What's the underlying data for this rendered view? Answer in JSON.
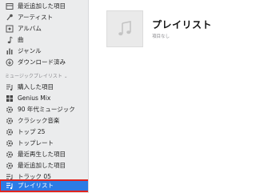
{
  "sidebar": {
    "library_items": [
      {
        "label": "最近追加した項目",
        "icon": "recently-added-icon"
      },
      {
        "label": "アーティスト",
        "icon": "artist-icon"
      },
      {
        "label": "アルバム",
        "icon": "album-icon"
      },
      {
        "label": "曲",
        "icon": "song-icon"
      },
      {
        "label": "ジャンル",
        "icon": "genre-icon"
      },
      {
        "label": "ダウンロード済み",
        "icon": "downloaded-icon"
      }
    ],
    "playlists_header": "ミュージックプレイリスト",
    "playlists": [
      {
        "label": "購入した項目",
        "icon": "playlist-icon"
      },
      {
        "label": "Genius Mix",
        "icon": "genius-mix-icon"
      },
      {
        "label": "90 年代ミュージック",
        "icon": "smart-playlist-icon"
      },
      {
        "label": "クラシック音楽",
        "icon": "smart-playlist-icon"
      },
      {
        "label": "トップ 25",
        "icon": "smart-playlist-icon"
      },
      {
        "label": "トップレート",
        "icon": "smart-playlist-icon"
      },
      {
        "label": "最近再生した項目",
        "icon": "smart-playlist-icon"
      },
      {
        "label": "最近追加した項目",
        "icon": "smart-playlist-icon"
      },
      {
        "label": "トラック 05",
        "icon": "playlist-icon"
      },
      {
        "label": "プレイリスト",
        "icon": "playlist-icon",
        "selected": true
      }
    ]
  },
  "main": {
    "title": "プレイリスト",
    "subtitle": "項目なし"
  },
  "colors": {
    "selection": "#2c7be5",
    "highlight_border": "#e0231e",
    "sidebar_bg": "#ebeced"
  }
}
